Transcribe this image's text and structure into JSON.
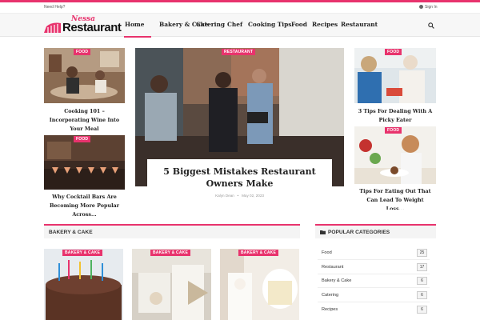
{
  "topbar": {
    "help": "Need Help?",
    "signin": "Sign In"
  },
  "logo": {
    "script": "Nessa",
    "word": "Restaurant"
  },
  "nav": {
    "items": [
      "Home",
      "Bakery & Cake",
      "Catering",
      "Chef",
      "Cooking Tips",
      "Food",
      "Recipes",
      "Restaurant"
    ],
    "active": "Home"
  },
  "posts": {
    "left_top": {
      "badge": "FOOD",
      "title": "Cooking 101 – Incorporating Wine Into Your Meal"
    },
    "left_bottom": {
      "badge": "FOOD",
      "title": "Why Cocktail Bars Are Becoming More Popular Across..."
    },
    "hero": {
      "badge": "RESTAURANT",
      "title": "5 Biggest Mistakes Restaurant Owners Make",
      "author": "Kalyn Dean",
      "date": "May 02, 2023"
    },
    "right_top": {
      "badge": "FOOD",
      "title": "3 Tips For Dealing With A Picky Eater"
    },
    "right_bottom": {
      "badge": "FOOD",
      "title": "Tips For Eating Out That Can Lead To Weight Loss..."
    }
  },
  "bakery_section": {
    "heading": "BAKERY & CAKE",
    "cards": [
      {
        "badge": "BAKERY & CAKE"
      },
      {
        "badge": "BAKERY & CAKE"
      },
      {
        "badge": "BAKERY & CAKE"
      }
    ]
  },
  "popular": {
    "heading": "POPULAR CATEGORIES",
    "items": [
      {
        "name": "Food",
        "count": "25"
      },
      {
        "name": "Restaurant",
        "count": "17"
      },
      {
        "name": "Bakery & Cake",
        "count": "6"
      },
      {
        "name": "Catering",
        "count": "6"
      },
      {
        "name": "Recipes",
        "count": "6"
      }
    ]
  },
  "colors": {
    "accent": "#e8336d",
    "text": "#222222",
    "muted": "#999999"
  },
  "icons": {
    "search": "search-icon",
    "user": "user-icon",
    "folder": "folder-icon",
    "logo": "logo-mark-icon"
  }
}
